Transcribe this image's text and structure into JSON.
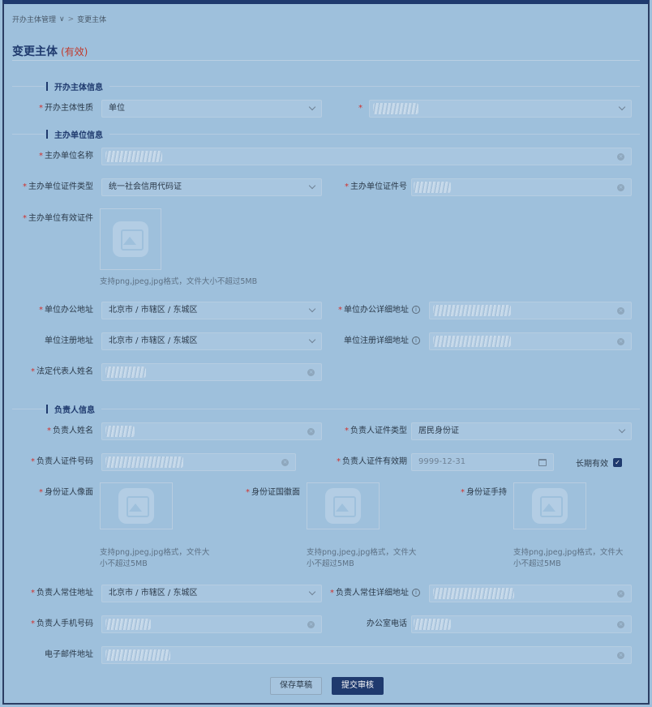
{
  "breadcrumb": {
    "parent": "开办主体管理",
    "current": "变更主体"
  },
  "page": {
    "title": "变更主体",
    "status": "(有效)"
  },
  "sections": {
    "organizer_info": "开办主体信息",
    "host_unit_info": "主办单位信息",
    "responsible_info": "负责人信息"
  },
  "fields": {
    "organizer_nature": {
      "label": "开办主体性质",
      "value": "单位"
    },
    "host_unit_name": {
      "label": "主办单位名称"
    },
    "host_cert_type": {
      "label": "主办单位证件类型",
      "value": "统一社会信用代码证"
    },
    "host_cert_no": {
      "label": "主办单位证件号"
    },
    "host_valid_cert": {
      "label": "主办单位有效证件"
    },
    "office_address": {
      "label": "单位办公地址",
      "value": "北京市 / 市辖区 / 东城区"
    },
    "office_detail": {
      "label": "单位办公详细地址"
    },
    "reg_address": {
      "label": "单位注册地址",
      "value": "北京市 / 市辖区 / 东城区"
    },
    "reg_detail": {
      "label": "单位注册详细地址"
    },
    "legal_rep": {
      "label": "法定代表人姓名"
    },
    "resp_name": {
      "label": "负责人姓名"
    },
    "resp_cert_type": {
      "label": "负责人证件类型",
      "value": "居民身份证"
    },
    "resp_cert_no": {
      "label": "负责人证件号码"
    },
    "resp_cert_valid": {
      "label": "负责人证件有效期",
      "value": "9999-12-31"
    },
    "long_term": {
      "label": "长期有效",
      "checked": true
    },
    "id_front": {
      "label": "身份证人像面"
    },
    "id_back": {
      "label": "身份证国徽面"
    },
    "id_hold": {
      "label": "身份证手持"
    },
    "resp_address": {
      "label": "负责人常住地址",
      "value": "北京市 / 市辖区 / 东城区"
    },
    "resp_addr_detail": {
      "label": "负责人常住详细地址"
    },
    "resp_phone": {
      "label": "负责人手机号码"
    },
    "office_phone": {
      "label": "办公室电话"
    },
    "email": {
      "label": "电子邮件地址"
    }
  },
  "hints": {
    "upload_wide": "支持png,jpeg,jpg格式，文件大小不超过5MB",
    "upload_line1": "支持png,jpeg,jpg格式，文件大",
    "upload_line2": "小不超过5MB"
  },
  "buttons": {
    "save_draft": "保存草稿",
    "submit": "提交审核"
  },
  "colors": {
    "accent": "#1f3a6e",
    "required": "#d0312d",
    "status": "#c0392b"
  }
}
